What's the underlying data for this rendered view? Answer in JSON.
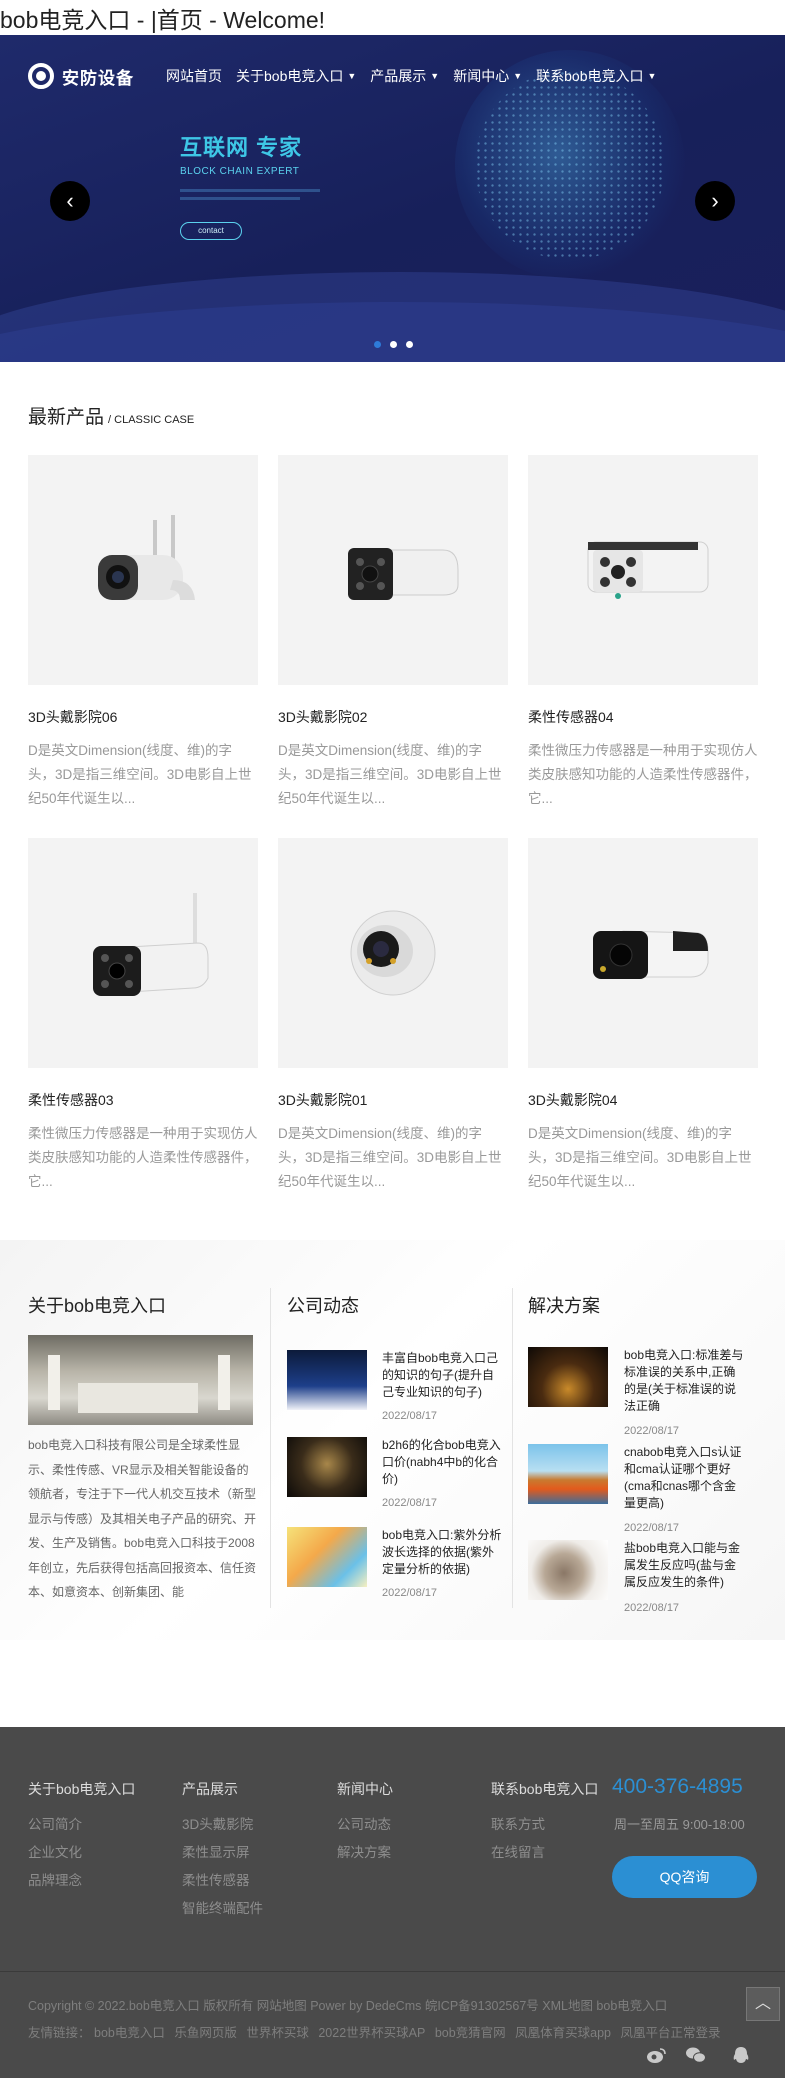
{
  "page": {
    "title": "bob电竞入口 - |首页 - Welcome!"
  },
  "header": {
    "logo_text": "安防设备",
    "nav": [
      {
        "label": "网站首页",
        "dropdown": false
      },
      {
        "label": "关于bob电竞入口",
        "dropdown": true
      },
      {
        "label": "产品展示",
        "dropdown": true
      },
      {
        "label": "新闻中心",
        "dropdown": true
      },
      {
        "label": "联系bob电竞入口",
        "dropdown": true
      }
    ]
  },
  "banner": {
    "headline": "互联网 专家",
    "subheadline": "BLOCK CHAIN EXPERT",
    "button": "contact",
    "prev": "‹",
    "next": "›",
    "slides": 3,
    "active_slide": 1
  },
  "products": {
    "title": "最新产品",
    "subtitle": "/ CLASSIC CASE",
    "items": [
      {
        "name": "3D头戴影院06",
        "desc": "D是英文Dimension(线度、维)的字头，3D是指三维空间。3D电影自上世纪50年代诞生以..."
      },
      {
        "name": "3D头戴影院02",
        "desc": "D是英文Dimension(线度、维)的字头，3D是指三维空间。3D电影自上世纪50年代诞生以..."
      },
      {
        "name": "柔性传感器04",
        "desc": "柔性微压力传感器是一种用于实现仿人类皮肤感知功能的人造柔性传感器件，它..."
      },
      {
        "name": "柔性传感器03",
        "desc": "柔性微压力传感器是一种用于实现仿人类皮肤感知功能的人造柔性传感器件，它..."
      },
      {
        "name": "3D头戴影院01",
        "desc": "D是英文Dimension(线度、维)的字头，3D是指三维空间。3D电影自上世纪50年代诞生以..."
      },
      {
        "name": "3D头戴影院04",
        "desc": "D是英文Dimension(线度、维)的字头，3D是指三维空间。3D电影自上世纪50年代诞生以..."
      }
    ]
  },
  "about": {
    "title": "关于bob电竞入口",
    "text": "bob电竞入口科技有限公司是全球柔性显示、柔性传感、VR显示及相关智能设备的领航者，专注于下一代人机交互技术（新型显示与传感）及其相关电子产品的研究、开发、生产及销售。bob电竞入口科技于2008年创立，先后获得包括高回报资本、信任资本、如意资本、创新集团、能"
  },
  "company_news": {
    "title": "公司动态",
    "items": [
      {
        "title": "丰富自bob电竞入口己的知识的句子(提升自己专业知识的句子)",
        "date": "2022/08/17"
      },
      {
        "title": "b2h6的化合bob电竞入口价(nabh4中b的化合价)",
        "date": "2022/08/17"
      },
      {
        "title": "bob电竞入口:紫外分析波长选择的依据(紫外定量分析的依据)",
        "date": "2022/08/17"
      }
    ]
  },
  "solutions": {
    "title": "解决方案",
    "items": [
      {
        "title": "bob电竞入口:标准差与标准误的关系中,正确的是(关于标准误的说法正确",
        "date": "2022/08/17"
      },
      {
        "title": "cnabob电竞入口s认证和cma认证哪个更好(cma和cnas哪个含金量更高)",
        "date": "2022/08/17"
      },
      {
        "title": "盐bob电竞入口能与金属发生反应吗(盐与金属反应发生的条件)",
        "date": "2022/08/17"
      }
    ]
  },
  "footer": {
    "columns": [
      {
        "title": "关于bob电竞入口",
        "links": [
          "公司简介",
          "企业文化",
          "品牌理念"
        ]
      },
      {
        "title": "产品展示",
        "links": [
          "3D头戴影院",
          "柔性显示屏",
          "柔性传感器",
          "智能终端配件"
        ]
      },
      {
        "title": "新闻中心",
        "links": [
          "公司动态",
          "解决方案"
        ]
      },
      {
        "title": "联系bob电竞入口",
        "links": [
          "联系方式",
          "在线留言"
        ]
      }
    ],
    "phone": "400-376-4895",
    "hours": "周一至周五 9:00-18:00",
    "qq_button": "QQ咨询",
    "copyright": "Copyright © 2022.bob电竞入口 版权所有 网站地图 Power by DedeCms 皖ICP备91302567号 XML地图 bob电竞入口",
    "friend_label": "友情链接：",
    "friend_links": [
      "bob电竞入口",
      "乐鱼网页版",
      "世界杯买球",
      "2022世界杯买球AP",
      "bob竞猜官网",
      "凤凰体育买球app",
      "凤凰平台正常登录"
    ],
    "to_top": "︿",
    "accent": "#2b8fd3"
  }
}
